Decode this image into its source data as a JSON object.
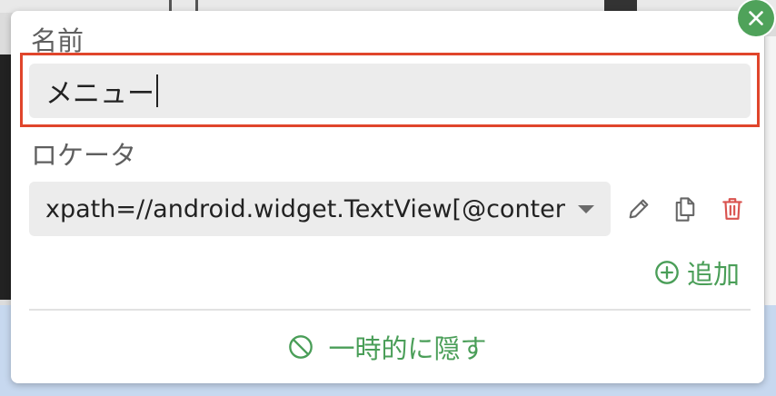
{
  "form": {
    "name_label": "名前",
    "name_value": "メニュー",
    "locator_label": "ロケータ",
    "locator_value": "xpath=//android.widget.TextView[@content"
  },
  "actions": {
    "add_label": "追加",
    "hide_label": "一時的に隠す"
  },
  "icons": {
    "edit": "pencil-icon",
    "copy": "copy-icon",
    "delete": "trash-icon",
    "add": "plus-circle-icon",
    "hide": "eye-off-icon",
    "close": "close-icon"
  },
  "colors": {
    "accent_green": "#4a9e58",
    "highlight_red": "#e0452b",
    "delete_red": "#d9534f"
  }
}
